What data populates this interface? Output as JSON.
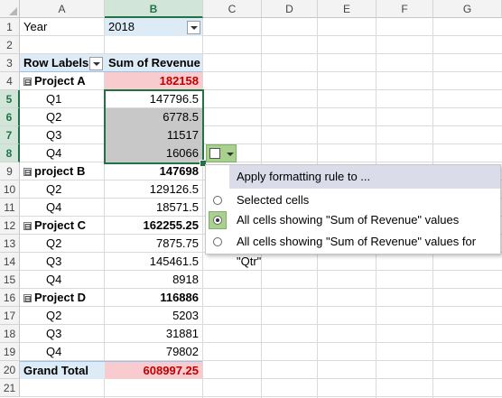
{
  "columns": [
    "A",
    "B",
    "C",
    "D",
    "E",
    "F",
    "G"
  ],
  "rows": [
    "1",
    "2",
    "3",
    "4",
    "5",
    "6",
    "7",
    "8",
    "9",
    "10",
    "11",
    "12",
    "13",
    "14",
    "15",
    "16",
    "17",
    "18",
    "19",
    "20",
    "21"
  ],
  "filter": {
    "label": "Year",
    "value": "2018"
  },
  "pivot_header": {
    "row_labels": "Row Labels",
    "sum_label": "Sum of Revenue"
  },
  "pivot_rows": [
    {
      "label": "Project A",
      "value": "182158",
      "type": "group",
      "highlight": "pink"
    },
    {
      "label": "Q1",
      "value": "147796.5",
      "type": "item",
      "highlight": "none"
    },
    {
      "label": "Q2",
      "value": "6778.5",
      "type": "item",
      "highlight": "gray"
    },
    {
      "label": "Q3",
      "value": "11517",
      "type": "item",
      "highlight": "gray"
    },
    {
      "label": "Q4",
      "value": "16066",
      "type": "item",
      "highlight": "gray"
    },
    {
      "label": "project B",
      "value": "147698",
      "type": "group",
      "highlight": "none"
    },
    {
      "label": "Q2",
      "value": "129126.5",
      "type": "item",
      "highlight": "none"
    },
    {
      "label": "Q4",
      "value": "18571.5",
      "type": "item",
      "highlight": "none"
    },
    {
      "label": "Project C",
      "value": "162255.25",
      "type": "group",
      "highlight": "none"
    },
    {
      "label": "Q2",
      "value": "7875.75",
      "type": "item",
      "highlight": "none"
    },
    {
      "label": "Q3",
      "value": "145461.5",
      "type": "item",
      "highlight": "none"
    },
    {
      "label": "Q4",
      "value": "8918",
      "type": "item",
      "highlight": "none"
    },
    {
      "label": "Project D",
      "value": "116886",
      "type": "group",
      "highlight": "none"
    },
    {
      "label": "Q2",
      "value": "5203",
      "type": "item",
      "highlight": "none"
    },
    {
      "label": "Q3",
      "value": "31881",
      "type": "item",
      "highlight": "none"
    },
    {
      "label": "Q4",
      "value": "79802",
      "type": "item",
      "highlight": "none"
    }
  ],
  "grand_total": {
    "label": "Grand Total",
    "value": "608997.25"
  },
  "selected_rows": [
    "5",
    "6",
    "7",
    "8"
  ],
  "selected_column": "B",
  "collapse_glyph": "⊟",
  "menu": {
    "title": "Apply formatting rule to ...",
    "options": [
      {
        "label": "Selected cells",
        "checked": false
      },
      {
        "label": "All cells showing \"Sum of Revenue\" values",
        "checked": true
      },
      {
        "label": "All cells showing \"Sum of Revenue\" values for \"Qtr\"",
        "checked": false
      }
    ]
  },
  "colors": {
    "accent": "#217346",
    "pink": "#f8cbcf",
    "pink_text": "#c00000",
    "header_blue": "#ddebf7",
    "gray": "#c8c8c8",
    "options_green": "#a9d08e"
  }
}
